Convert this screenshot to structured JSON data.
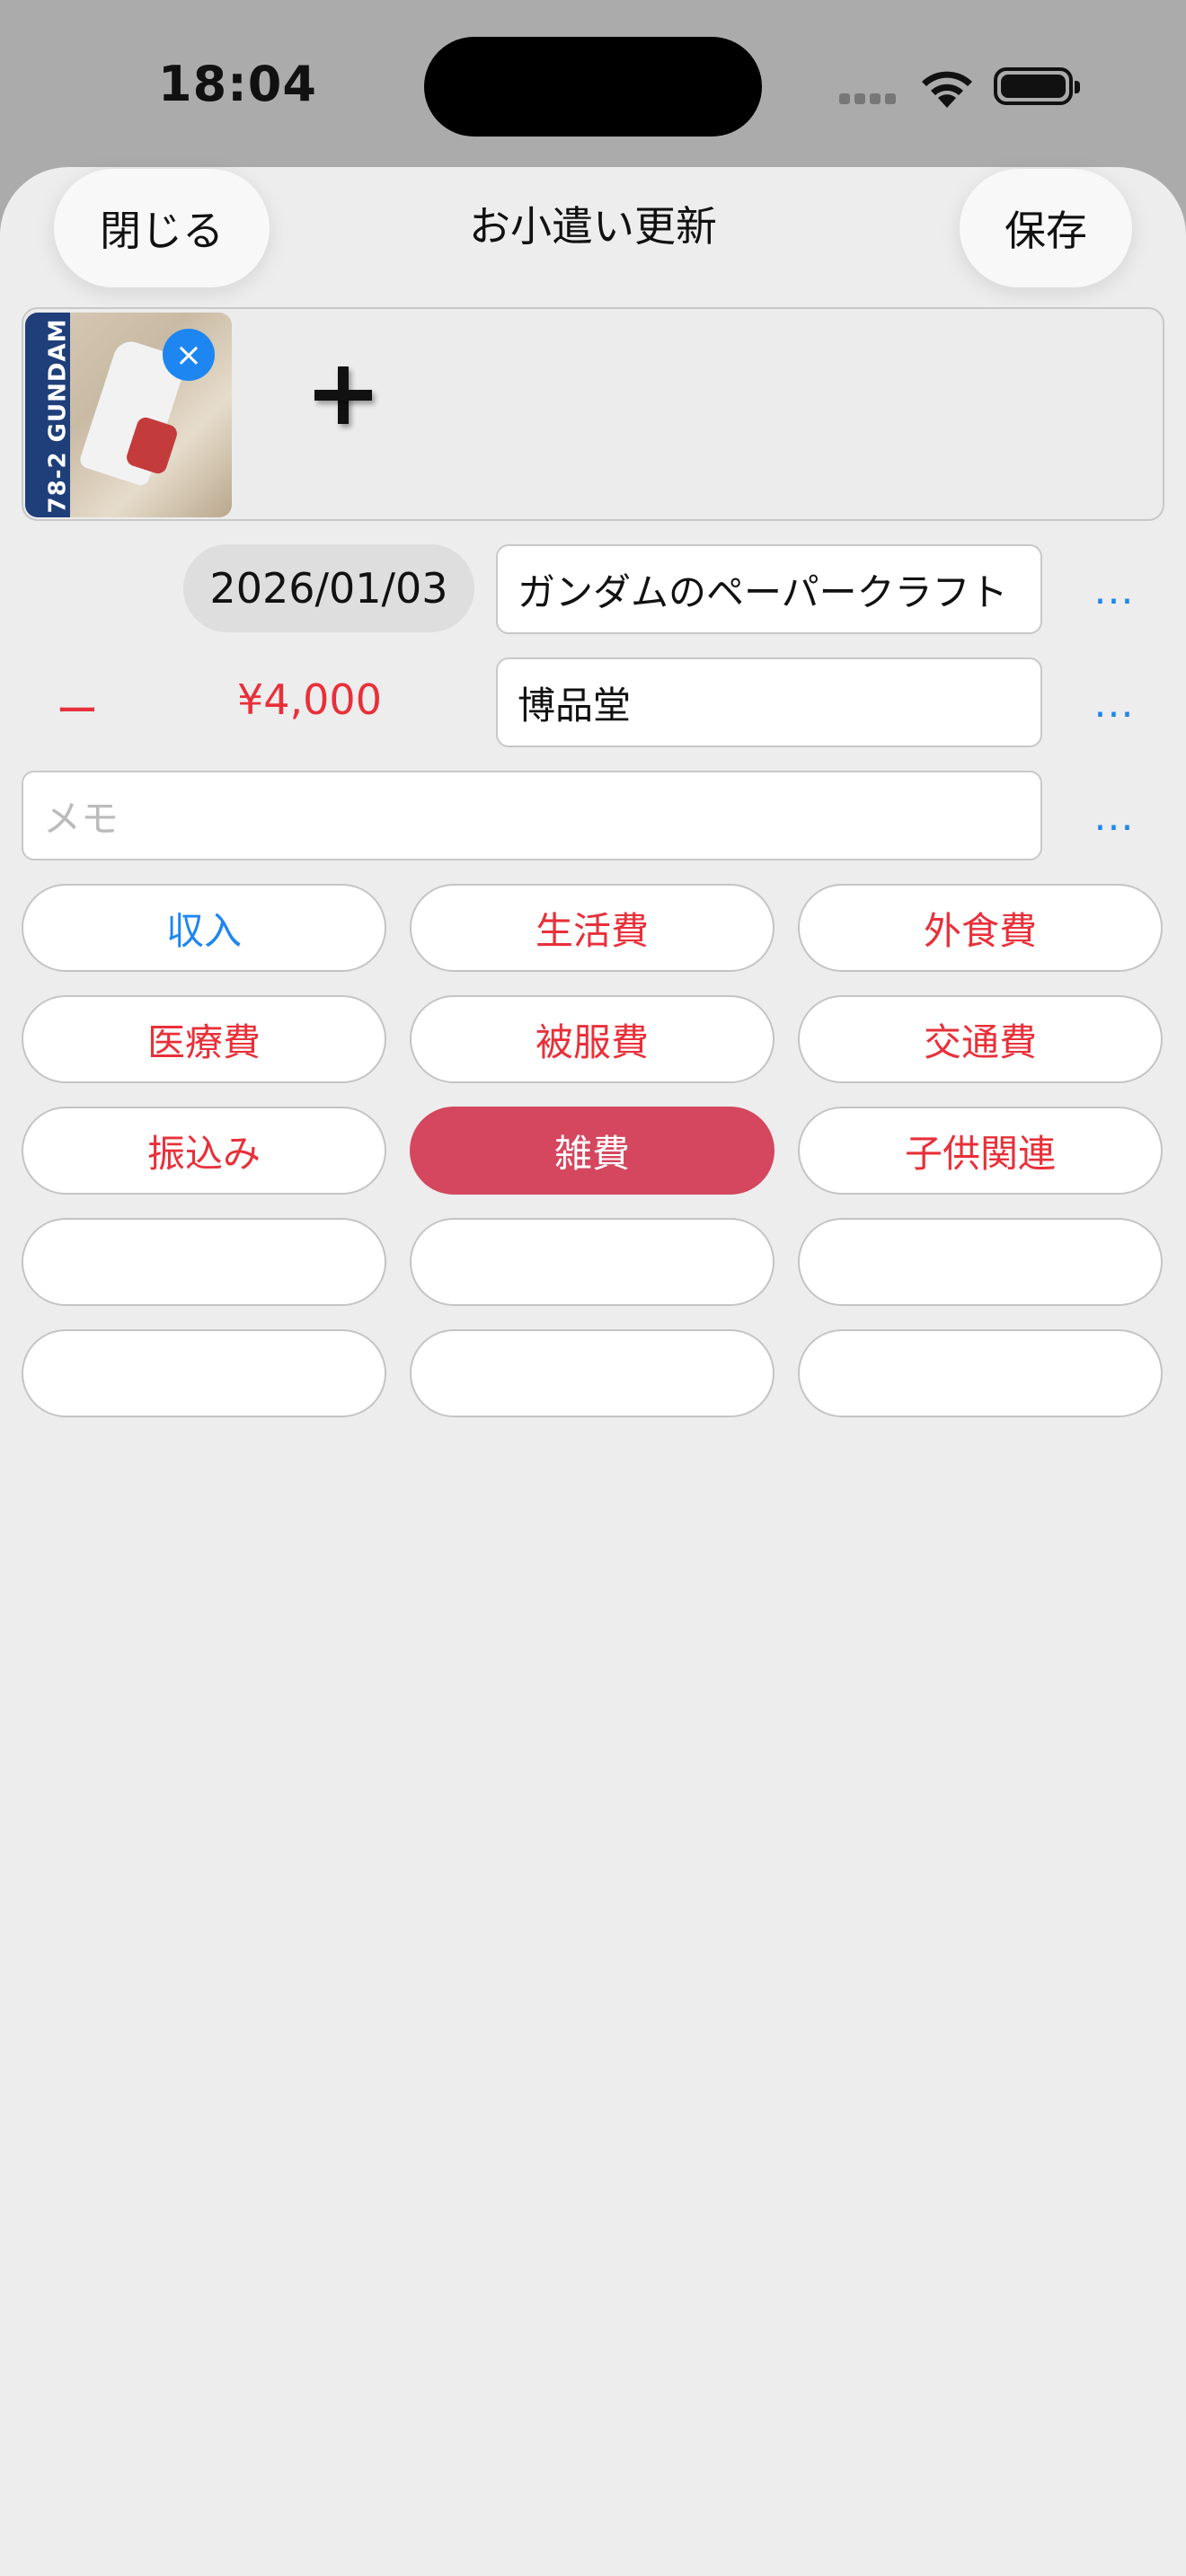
{
  "status_bar": {
    "time": "18:04"
  },
  "nav": {
    "title": "お小遣い更新",
    "close_label": "閉じる",
    "save_label": "保存"
  },
  "photo": {
    "thumbnail_text": "78-2 GUNDAM",
    "remove_icon": "×"
  },
  "entry": {
    "date": "2026/01/03",
    "item_name": "ガンダムのペーパークラフト",
    "sign": "ー",
    "amount": "¥4,000",
    "shop": "博品堂",
    "memo_placeholder": "メモ",
    "more_label": "..."
  },
  "categories": [
    {
      "label": "収入",
      "type": "income",
      "selected": false
    },
    {
      "label": "生活費",
      "type": "expense",
      "selected": false
    },
    {
      "label": "外食費",
      "type": "expense",
      "selected": false
    },
    {
      "label": "医療費",
      "type": "expense",
      "selected": false
    },
    {
      "label": "被服費",
      "type": "expense",
      "selected": false
    },
    {
      "label": "交通費",
      "type": "expense",
      "selected": false
    },
    {
      "label": "振込み",
      "type": "expense",
      "selected": false
    },
    {
      "label": "雑費",
      "type": "expense",
      "selected": true
    },
    {
      "label": "子供関連",
      "type": "expense",
      "selected": false
    },
    {
      "label": "",
      "type": "empty",
      "selected": false
    },
    {
      "label": "",
      "type": "empty",
      "selected": false
    },
    {
      "label": "",
      "type": "empty",
      "selected": false
    },
    {
      "label": "",
      "type": "empty",
      "selected": false
    },
    {
      "label": "",
      "type": "empty",
      "selected": false
    },
    {
      "label": "",
      "type": "empty",
      "selected": false
    }
  ],
  "colors": {
    "accent_blue": "#1e86f0",
    "expense_red": "#e8303a",
    "selected_bg": "#d4475f"
  }
}
